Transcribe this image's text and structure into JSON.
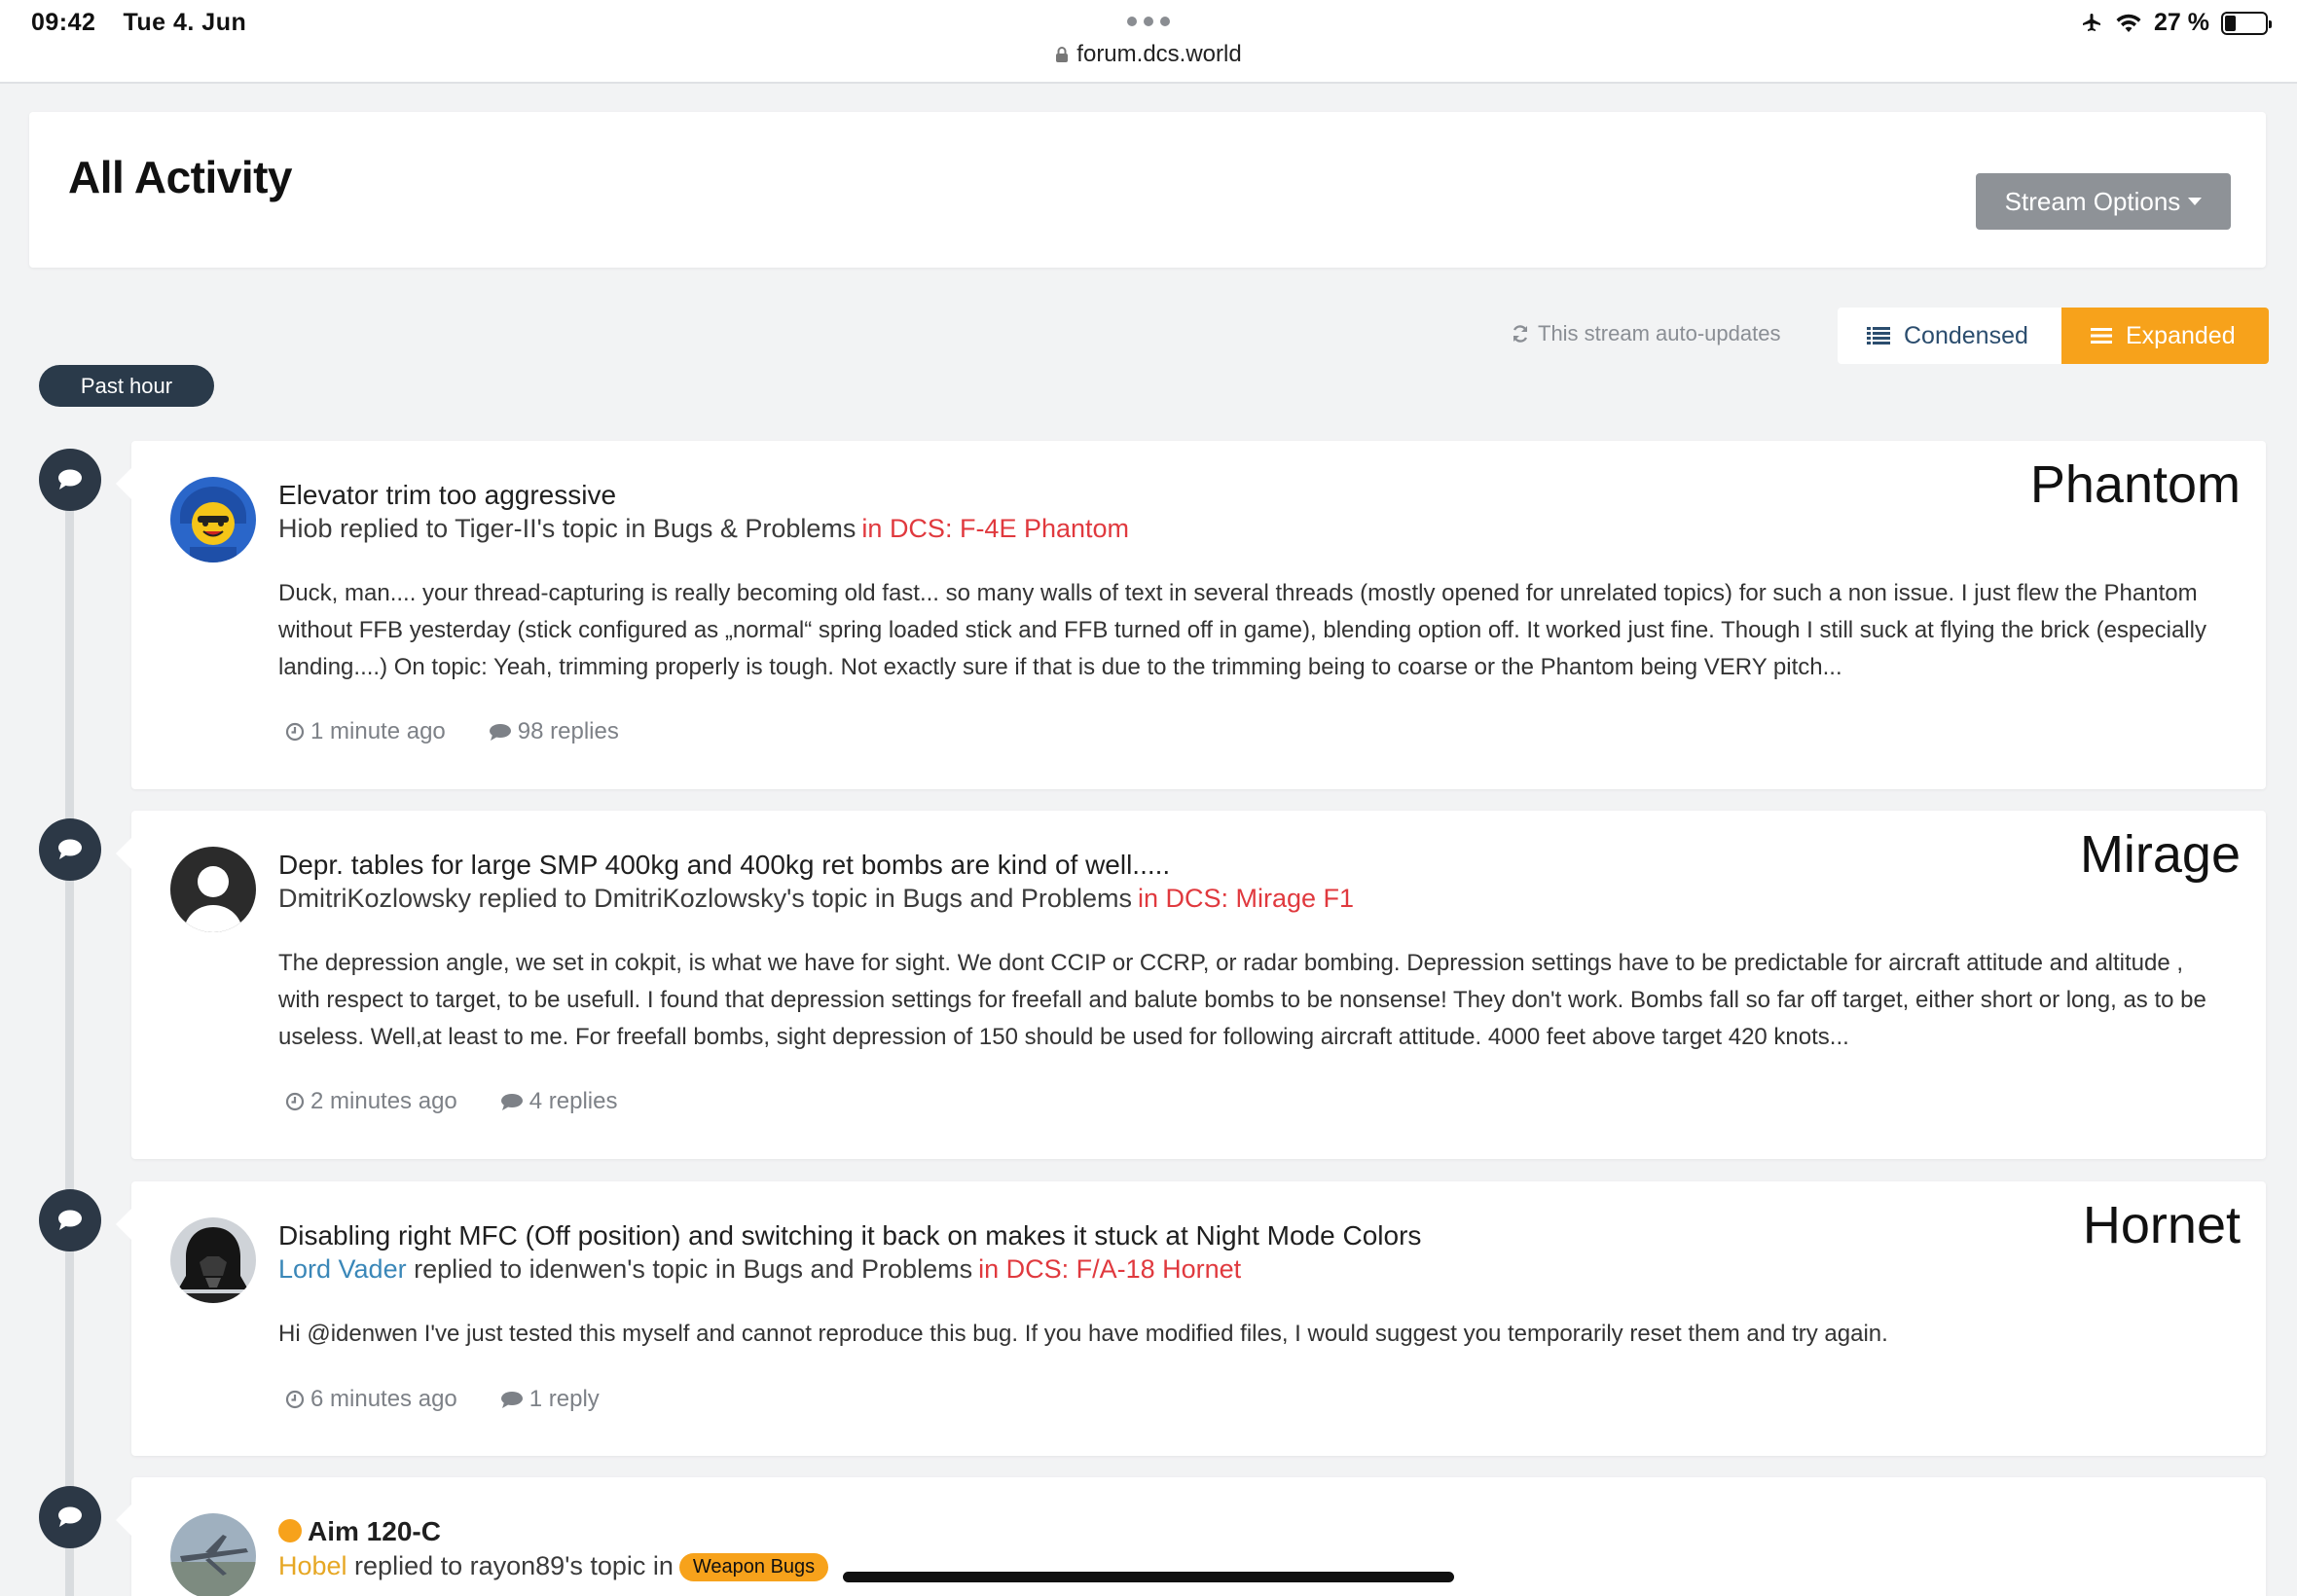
{
  "status_bar": {
    "time": "09:42",
    "date": "Tue 4. Jun",
    "url": "forum.dcs.world",
    "battery": "27 %",
    "battery_level": 0.27
  },
  "header": {
    "title": "All Activity",
    "stream_options_label": "Stream Options"
  },
  "view": {
    "auto_updates": "This stream auto-updates",
    "condensed_label": "Condensed",
    "expanded_label": "Expanded",
    "active": "expanded"
  },
  "timeline": {
    "period_label": "Past hour"
  },
  "activities": [
    {
      "title": "Elevator trim too aggressive",
      "author": "Hiob",
      "action": " replied to Tiger-II's topic in Bugs & Problems",
      "forum": "in DCS: F-4E Phantom",
      "body": "Duck, man.... your thread-capturing is really becoming old fast... so many walls of text in several threads (mostly opened for unrelated topics) for such a non issue. I just flew the Phantom without FFB yesterday (stick configured as „normal“ spring loaded stick and FFB turned off in game), blending option off. It worked just fine. Though I still suck at flying the brick (especially landing....) On topic: Yeah, trimming properly is tough. Not exactly sure if that is due to the trimming being to coarse or the Phantom being VERY pitch...",
      "time": "1 minute ago",
      "replies": "98 replies",
      "overlay": "Phantom"
    },
    {
      "title": "Depr. tables for large SMP 400kg and 400kg ret bombs are kind of well.....",
      "author": "DmitriKozlowsky",
      "action": " replied to DmitriKozlowsky's topic in Bugs and Problems",
      "forum": "in DCS: Mirage F1",
      "body": "The depression angle, we set in cokpit, is what we have for sight. We dont CCIP or CCRP, or radar bombing. Depression settings have to be predictable for aircraft attitude and altitude , with respect to target, to be usefull. I found that depression settings for freefall and balute bombs to be nonsense! They don't work. Bombs fall so far off target, either short or long, as to be useless. Well,at least to me. For freefall bombs, sight depression of 150 should be used for following aircraft attitude. 4000 feet above target 420 knots...",
      "time": "2 minutes ago",
      "replies": "4 replies",
      "overlay": "Mirage"
    },
    {
      "title": "Disabling right MFC (Off position) and switching it back on makes it stuck at Night Mode Colors",
      "author": "Lord Vader",
      "action": " replied to idenwen's topic in Bugs and Problems",
      "forum": "in DCS: F/A-18 Hornet",
      "body": "Hi @idenwen I've just tested this myself and cannot reproduce this bug. If you have modified files, I would suggest you temporarily reset them and try again.",
      "time": "6 minutes ago",
      "replies": "1 reply",
      "overlay": "Hornet"
    },
    {
      "title": "Aim 120-C",
      "author": "Hobel",
      "action": " replied to rayon89's topic in",
      "forum_tag": "Weapon Bugs"
    }
  ],
  "colors": {
    "accent": "#f7a21b",
    "dark": "#2c3846",
    "forum_link": "#e0393e",
    "author_link": "#3a87b8"
  }
}
